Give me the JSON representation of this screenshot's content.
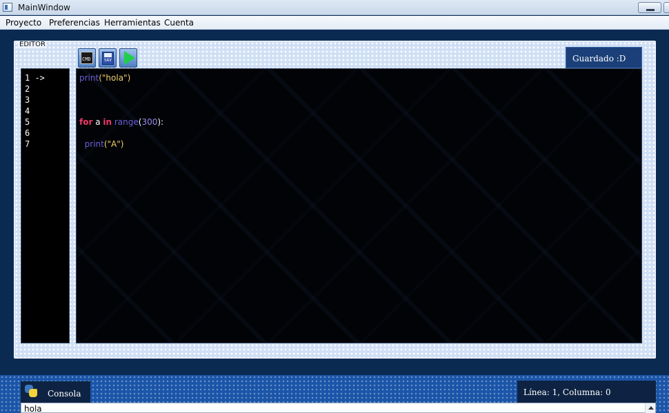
{
  "window": {
    "title": "MainWindow"
  },
  "menu": {
    "items": [
      "Proyecto",
      "Preferencias",
      "Herramientas",
      "Cuenta"
    ]
  },
  "editor": {
    "label": "EDITOR",
    "toolbar": {
      "cmd_icon_text": "CMD",
      "save_icon_text": "SAV"
    },
    "status": "Guardado :D",
    "line_numbers": [
      "1 ->",
      "2",
      "3",
      "4",
      "5",
      "6",
      "7"
    ],
    "code": {
      "line1": {
        "func": "print",
        "open": "(",
        "string": "\"hola\"",
        "close": ")"
      },
      "line5": {
        "kw_for": "for",
        "var": " a ",
        "kw_in": "in",
        "space": " ",
        "func": "range",
        "open": "(",
        "num": "300",
        "close": "):"
      },
      "line7": {
        "indent": "  ",
        "func": "print",
        "open": "(",
        "string": "\"A\"",
        "close": ")"
      }
    }
  },
  "console": {
    "tab_label": "Consola",
    "cursor_position": "Línea: 1, Columna: 0",
    "input_value": "hola"
  },
  "colors": {
    "keyword": "#f03a6a",
    "function": "#6b5fd8",
    "string": "#f2d06b",
    "number": "#9c8cf2",
    "editor_background": "#020306",
    "accent": "#1b3f78"
  },
  "icons": [
    "app-window-icon",
    "minimize-icon",
    "maximize-icon",
    "cmd-console-icon",
    "save-disk-icon",
    "run-play-icon",
    "python-logo-icon",
    "scroll-up-icon"
  ]
}
